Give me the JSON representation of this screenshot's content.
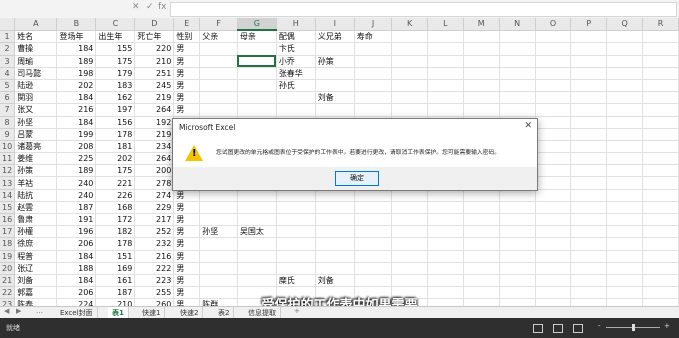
{
  "formula_bar": {
    "cancel": "✕",
    "enter": "✓",
    "fx": "fx"
  },
  "sheet": {
    "columns": [
      "A",
      "B",
      "C",
      "D",
      "E",
      "F",
      "G",
      "H",
      "I",
      "J",
      "K",
      "L",
      "M",
      "N",
      "O",
      "P",
      "Q",
      "R"
    ],
    "header_row": [
      "姓名",
      "登场年",
      "出生年",
      "死亡年",
      "性别",
      "父亲",
      "母亲",
      "配偶",
      "义兄弟",
      "寿命"
    ],
    "rows": [
      [
        "曹操",
        "184",
        "155",
        "220",
        "男",
        "",
        "",
        "卞氏",
        "",
        ""
      ],
      [
        "周瑜",
        "189",
        "175",
        "210",
        "男",
        "",
        "",
        "小乔",
        "孙策",
        ""
      ],
      [
        "司马懿",
        "198",
        "179",
        "251",
        "男",
        "",
        "",
        "张春华",
        "",
        ""
      ],
      [
        "陆逊",
        "202",
        "183",
        "245",
        "男",
        "",
        "",
        "孙氏",
        "",
        ""
      ],
      [
        "関羽",
        "184",
        "162",
        "219",
        "男",
        "",
        "",
        "",
        "刘备",
        ""
      ],
      [
        "张又",
        "216",
        "197",
        "264",
        "男",
        "",
        "",
        "",
        "",
        ""
      ],
      [
        "孙坚",
        "184",
        "156",
        "192",
        "男",
        "",
        "",
        "吴国太",
        "",
        ""
      ],
      [
        "吕蒙",
        "199",
        "178",
        "219",
        "男",
        "",
        "",
        "",
        "",
        ""
      ],
      [
        "诸葛亮",
        "208",
        "181",
        "234",
        "男",
        "",
        "",
        "",
        "",
        ""
      ],
      [
        "姜维",
        "225",
        "202",
        "264",
        "男",
        "",
        "",
        "",
        "",
        ""
      ],
      [
        "孙策",
        "189",
        "175",
        "200",
        "男",
        "",
        "",
        "",
        "",
        ""
      ],
      [
        "羊祜",
        "240",
        "221",
        "278",
        "男",
        "",
        "",
        "",
        "",
        ""
      ],
      [
        "陆抗",
        "240",
        "226",
        "274",
        "男",
        "",
        "",
        "",
        "",
        ""
      ],
      [
        "赵雲",
        "187",
        "168",
        "229",
        "男",
        "",
        "",
        "",
        "",
        ""
      ],
      [
        "鲁肃",
        "191",
        "172",
        "217",
        "男",
        "",
        "",
        "",
        "",
        ""
      ],
      [
        "孙權",
        "196",
        "182",
        "252",
        "男",
        "孙坚",
        "吴国太",
        "",
        "",
        ""
      ],
      [
        "徐庶",
        "206",
        "178",
        "232",
        "男",
        "",
        "",
        "",
        "",
        ""
      ],
      [
        "程普",
        "184",
        "151",
        "216",
        "男",
        "",
        "",
        "",
        "",
        ""
      ],
      [
        "张辽",
        "188",
        "169",
        "222",
        "男",
        "",
        "",
        "",
        "",
        ""
      ],
      [
        "刘备",
        "184",
        "161",
        "223",
        "男",
        "",
        "",
        "糜氏",
        "刘备",
        ""
      ],
      [
        "郭嘉",
        "206",
        "187",
        "255",
        "男",
        "",
        "",
        "",
        "",
        ""
      ],
      [
        "陈泰",
        "224",
        "210",
        "260",
        "男",
        "陈群",
        "",
        "",
        "",
        ""
      ],
      [
        "卢植",
        "184",
        "139",
        "192",
        "男",
        "",
        "",
        "",
        "",
        ""
      ],
      [
        "满宠",
        "189",
        "170",
        "242",
        "男",
        "",
        "",
        "",
        "",
        ""
      ]
    ],
    "active_column": "G",
    "active_row": 3
  },
  "dialog": {
    "title": "Microsoft Excel",
    "close": "✕",
    "icon": "warning-icon",
    "message": "您试图更改的单元格或图表位于受保护的工作表中。若要进行更改，请取消工作表保护。您可能需要输入密码。",
    "ok_label": "确定"
  },
  "tabs": {
    "items": [
      "Excel封面",
      "表1",
      "快速1",
      "快速2",
      "表2",
      "信息提取"
    ],
    "active_index": 1,
    "nav_prev": "◀",
    "nav_next": "▶",
    "add": "+",
    "more": "…"
  },
  "status": {
    "mode": "就绪",
    "zoom_minus": "-",
    "zoom_plus": "+"
  },
  "subtitle": "受保护的工作表中如果需要"
}
